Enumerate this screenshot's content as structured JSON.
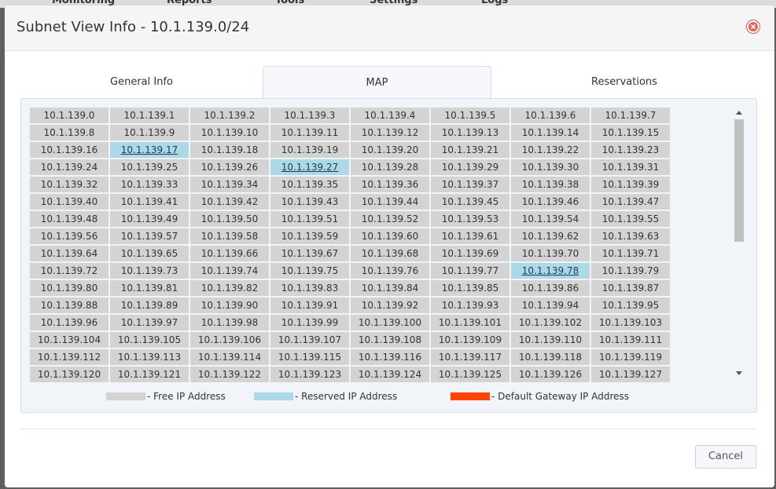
{
  "background_nav": {
    "items": [
      "Monitoring",
      "Reports",
      "Tools",
      "Settings",
      "Logs"
    ]
  },
  "modal": {
    "title": "Subnet View Info - 10.1.139.0/24",
    "close_icon": "close-circle-icon"
  },
  "tabs": [
    {
      "label": "General Info",
      "active": false
    },
    {
      "label": "MAP",
      "active": true
    },
    {
      "label": "Reservations",
      "active": false
    }
  ],
  "ip_map": {
    "columns": 8,
    "cells": [
      {
        "ip": "10.1.139.0",
        "status": "free"
      },
      {
        "ip": "10.1.139.1",
        "status": "free"
      },
      {
        "ip": "10.1.139.2",
        "status": "free"
      },
      {
        "ip": "10.1.139.3",
        "status": "free"
      },
      {
        "ip": "10.1.139.4",
        "status": "free"
      },
      {
        "ip": "10.1.139.5",
        "status": "free"
      },
      {
        "ip": "10.1.139.6",
        "status": "free"
      },
      {
        "ip": "10.1.139.7",
        "status": "free"
      },
      {
        "ip": "10.1.139.8",
        "status": "free"
      },
      {
        "ip": "10.1.139.9",
        "status": "free"
      },
      {
        "ip": "10.1.139.10",
        "status": "free"
      },
      {
        "ip": "10.1.139.11",
        "status": "free"
      },
      {
        "ip": "10.1.139.12",
        "status": "free"
      },
      {
        "ip": "10.1.139.13",
        "status": "free"
      },
      {
        "ip": "10.1.139.14",
        "status": "free"
      },
      {
        "ip": "10.1.139.15",
        "status": "free"
      },
      {
        "ip": "10.1.139.16",
        "status": "free"
      },
      {
        "ip": "10.1.139.17",
        "status": "reserved"
      },
      {
        "ip": "10.1.139.18",
        "status": "free"
      },
      {
        "ip": "10.1.139.19",
        "status": "free"
      },
      {
        "ip": "10.1.139.20",
        "status": "free"
      },
      {
        "ip": "10.1.139.21",
        "status": "free"
      },
      {
        "ip": "10.1.139.22",
        "status": "free"
      },
      {
        "ip": "10.1.139.23",
        "status": "free"
      },
      {
        "ip": "10.1.139.24",
        "status": "free"
      },
      {
        "ip": "10.1.139.25",
        "status": "free"
      },
      {
        "ip": "10.1.139.26",
        "status": "free"
      },
      {
        "ip": "10.1.139.27",
        "status": "reserved"
      },
      {
        "ip": "10.1.139.28",
        "status": "free"
      },
      {
        "ip": "10.1.139.29",
        "status": "free"
      },
      {
        "ip": "10.1.139.30",
        "status": "free"
      },
      {
        "ip": "10.1.139.31",
        "status": "free"
      },
      {
        "ip": "10.1.139.32",
        "status": "free"
      },
      {
        "ip": "10.1.139.33",
        "status": "free"
      },
      {
        "ip": "10.1.139.34",
        "status": "free"
      },
      {
        "ip": "10.1.139.35",
        "status": "free"
      },
      {
        "ip": "10.1.139.36",
        "status": "free"
      },
      {
        "ip": "10.1.139.37",
        "status": "free"
      },
      {
        "ip": "10.1.139.38",
        "status": "free"
      },
      {
        "ip": "10.1.139.39",
        "status": "free"
      },
      {
        "ip": "10.1.139.40",
        "status": "free"
      },
      {
        "ip": "10.1.139.41",
        "status": "free"
      },
      {
        "ip": "10.1.139.42",
        "status": "free"
      },
      {
        "ip": "10.1.139.43",
        "status": "free"
      },
      {
        "ip": "10.1.139.44",
        "status": "free"
      },
      {
        "ip": "10.1.139.45",
        "status": "free"
      },
      {
        "ip": "10.1.139.46",
        "status": "free"
      },
      {
        "ip": "10.1.139.47",
        "status": "free"
      },
      {
        "ip": "10.1.139.48",
        "status": "free"
      },
      {
        "ip": "10.1.139.49",
        "status": "free"
      },
      {
        "ip": "10.1.139.50",
        "status": "free"
      },
      {
        "ip": "10.1.139.51",
        "status": "free"
      },
      {
        "ip": "10.1.139.52",
        "status": "free"
      },
      {
        "ip": "10.1.139.53",
        "status": "free"
      },
      {
        "ip": "10.1.139.54",
        "status": "free"
      },
      {
        "ip": "10.1.139.55",
        "status": "free"
      },
      {
        "ip": "10.1.139.56",
        "status": "free"
      },
      {
        "ip": "10.1.139.57",
        "status": "free"
      },
      {
        "ip": "10.1.139.58",
        "status": "free"
      },
      {
        "ip": "10.1.139.59",
        "status": "free"
      },
      {
        "ip": "10.1.139.60",
        "status": "free"
      },
      {
        "ip": "10.1.139.61",
        "status": "free"
      },
      {
        "ip": "10.1.139.62",
        "status": "free"
      },
      {
        "ip": "10.1.139.63",
        "status": "free"
      },
      {
        "ip": "10.1.139.64",
        "status": "free"
      },
      {
        "ip": "10.1.139.65",
        "status": "free"
      },
      {
        "ip": "10.1.139.66",
        "status": "free"
      },
      {
        "ip": "10.1.139.67",
        "status": "free"
      },
      {
        "ip": "10.1.139.68",
        "status": "free"
      },
      {
        "ip": "10.1.139.69",
        "status": "free"
      },
      {
        "ip": "10.1.139.70",
        "status": "free"
      },
      {
        "ip": "10.1.139.71",
        "status": "free"
      },
      {
        "ip": "10.1.139.72",
        "status": "free"
      },
      {
        "ip": "10.1.139.73",
        "status": "free"
      },
      {
        "ip": "10.1.139.74",
        "status": "free"
      },
      {
        "ip": "10.1.139.75",
        "status": "free"
      },
      {
        "ip": "10.1.139.76",
        "status": "free"
      },
      {
        "ip": "10.1.139.77",
        "status": "free"
      },
      {
        "ip": "10.1.139.78",
        "status": "reserved"
      },
      {
        "ip": "10.1.139.79",
        "status": "free"
      },
      {
        "ip": "10.1.139.80",
        "status": "free"
      },
      {
        "ip": "10.1.139.81",
        "status": "free"
      },
      {
        "ip": "10.1.139.82",
        "status": "free"
      },
      {
        "ip": "10.1.139.83",
        "status": "free"
      },
      {
        "ip": "10.1.139.84",
        "status": "free"
      },
      {
        "ip": "10.1.139.85",
        "status": "free"
      },
      {
        "ip": "10.1.139.86",
        "status": "free"
      },
      {
        "ip": "10.1.139.87",
        "status": "free"
      },
      {
        "ip": "10.1.139.88",
        "status": "free"
      },
      {
        "ip": "10.1.139.89",
        "status": "free"
      },
      {
        "ip": "10.1.139.90",
        "status": "free"
      },
      {
        "ip": "10.1.139.91",
        "status": "free"
      },
      {
        "ip": "10.1.139.92",
        "status": "free"
      },
      {
        "ip": "10.1.139.93",
        "status": "free"
      },
      {
        "ip": "10.1.139.94",
        "status": "free"
      },
      {
        "ip": "10.1.139.95",
        "status": "free"
      },
      {
        "ip": "10.1.139.96",
        "status": "free"
      },
      {
        "ip": "10.1.139.97",
        "status": "free"
      },
      {
        "ip": "10.1.139.98",
        "status": "free"
      },
      {
        "ip": "10.1.139.99",
        "status": "free"
      },
      {
        "ip": "10.1.139.100",
        "status": "free"
      },
      {
        "ip": "10.1.139.101",
        "status": "free"
      },
      {
        "ip": "10.1.139.102",
        "status": "free"
      },
      {
        "ip": "10.1.139.103",
        "status": "free"
      },
      {
        "ip": "10.1.139.104",
        "status": "free"
      },
      {
        "ip": "10.1.139.105",
        "status": "free"
      },
      {
        "ip": "10.1.139.106",
        "status": "free"
      },
      {
        "ip": "10.1.139.107",
        "status": "free"
      },
      {
        "ip": "10.1.139.108",
        "status": "free"
      },
      {
        "ip": "10.1.139.109",
        "status": "free"
      },
      {
        "ip": "10.1.139.110",
        "status": "free"
      },
      {
        "ip": "10.1.139.111",
        "status": "free"
      },
      {
        "ip": "10.1.139.112",
        "status": "free"
      },
      {
        "ip": "10.1.139.113",
        "status": "free"
      },
      {
        "ip": "10.1.139.114",
        "status": "free"
      },
      {
        "ip": "10.1.139.115",
        "status": "free"
      },
      {
        "ip": "10.1.139.116",
        "status": "free"
      },
      {
        "ip": "10.1.139.117",
        "status": "free"
      },
      {
        "ip": "10.1.139.118",
        "status": "free"
      },
      {
        "ip": "10.1.139.119",
        "status": "free"
      },
      {
        "ip": "10.1.139.120",
        "status": "free"
      },
      {
        "ip": "10.1.139.121",
        "status": "free"
      },
      {
        "ip": "10.1.139.122",
        "status": "free"
      },
      {
        "ip": "10.1.139.123",
        "status": "free"
      },
      {
        "ip": "10.1.139.124",
        "status": "free"
      },
      {
        "ip": "10.1.139.125",
        "status": "free"
      },
      {
        "ip": "10.1.139.126",
        "status": "free"
      },
      {
        "ip": "10.1.139.127",
        "status": "free"
      }
    ]
  },
  "legend": [
    {
      "label": "- Free IP Address",
      "color": "#d3d3d3"
    },
    {
      "label": "- Reserved IP Address",
      "color": "#add8e6"
    },
    {
      "label": "- Default Gateway IP Address",
      "color": "#ff4500"
    }
  ],
  "footer": {
    "cancel_label": "Cancel"
  },
  "colors": {
    "free": "#d3d3d3",
    "reserved": "#add8e6",
    "gateway": "#ff4500",
    "close_red": "#d9534f"
  }
}
